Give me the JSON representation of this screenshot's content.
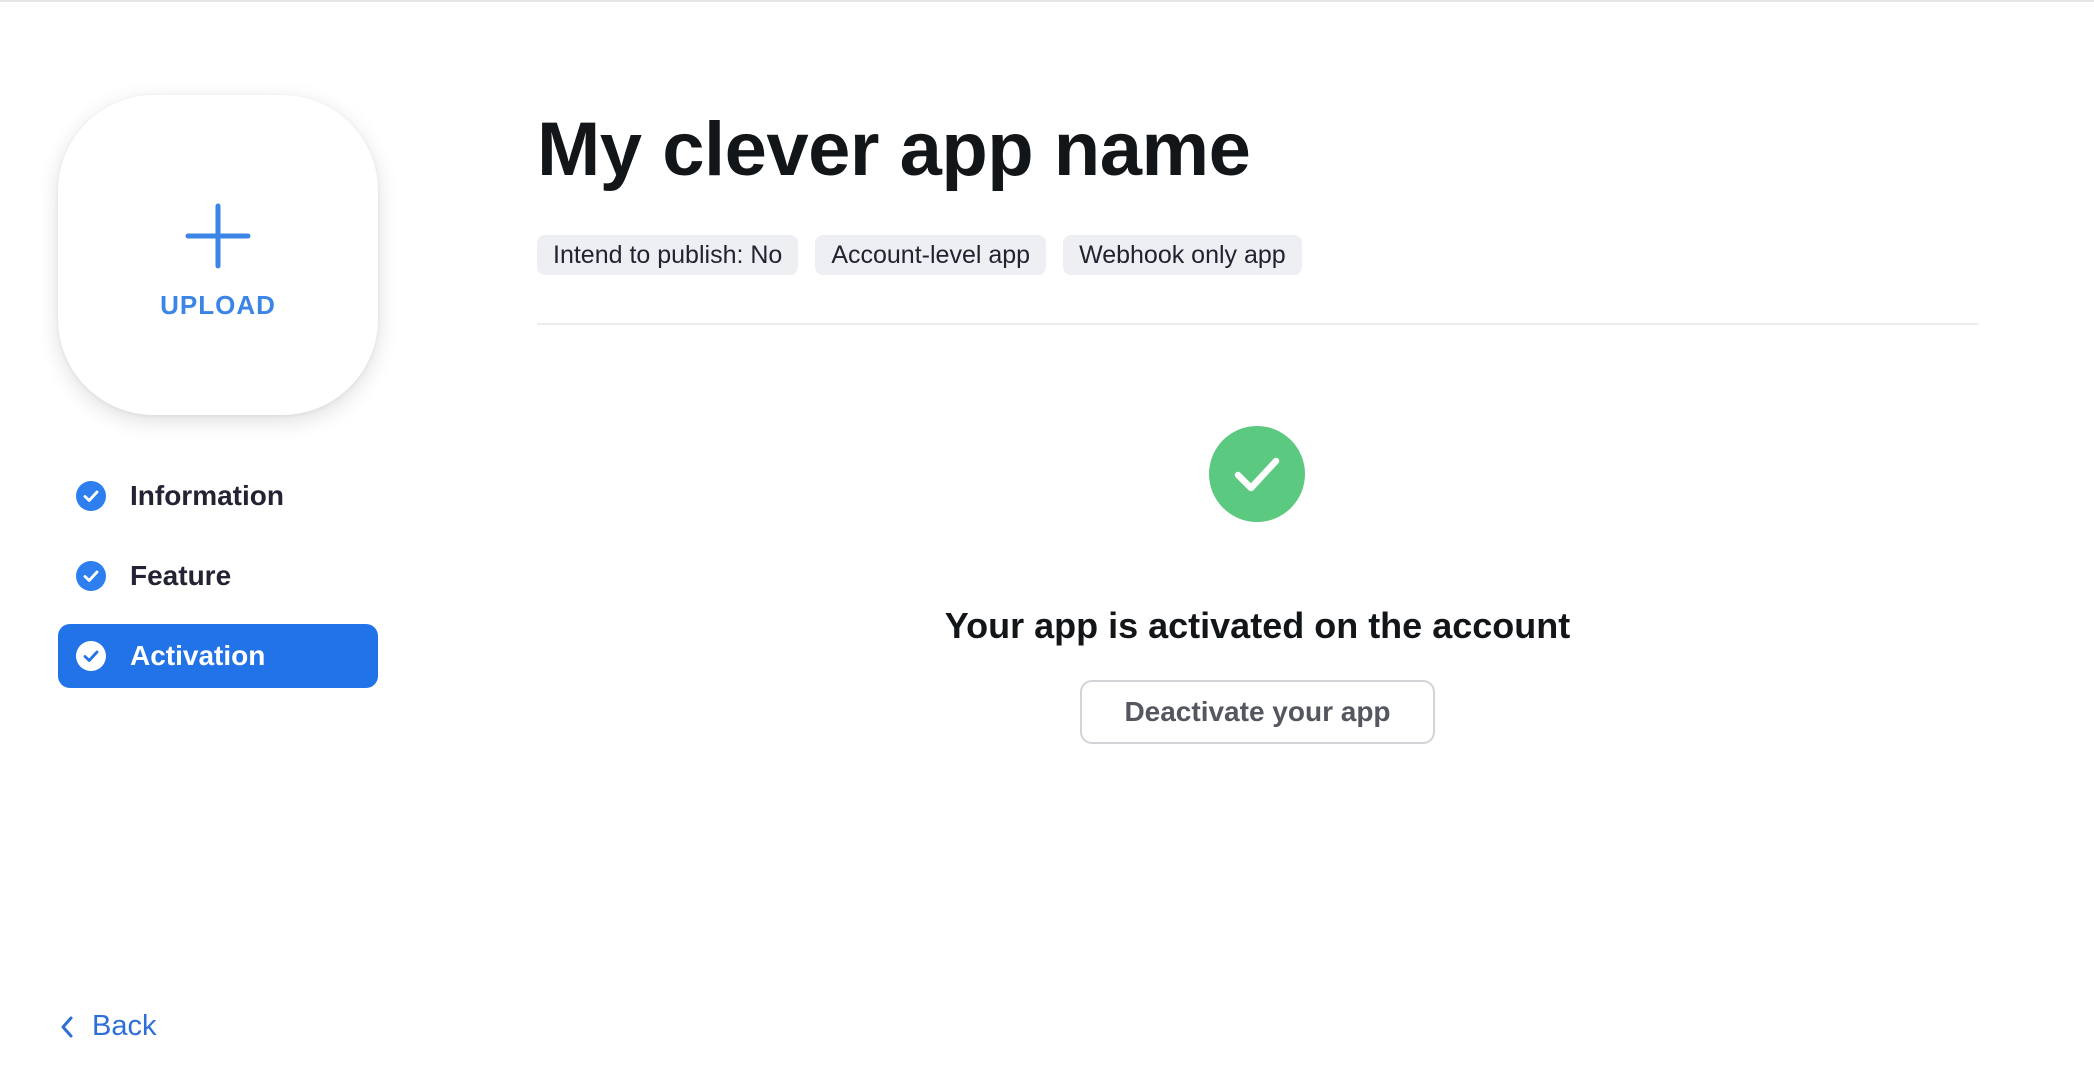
{
  "sidebar": {
    "upload_label": "UPLOAD",
    "steps": [
      {
        "label": "Information",
        "completed": true,
        "active": false
      },
      {
        "label": "Feature",
        "completed": true,
        "active": false
      },
      {
        "label": "Activation",
        "completed": true,
        "active": true
      }
    ],
    "back_label": "Back"
  },
  "main": {
    "title": "My clever app name",
    "tags": [
      "Intend to publish: No",
      "Account-level app",
      "Webhook only app"
    ],
    "status_text": "Your app is activated on the account",
    "deactivate_label": "Deactivate your app"
  },
  "colors": {
    "accent": "#2272e8",
    "success": "#5cc980",
    "link": "#2d6fd6"
  }
}
